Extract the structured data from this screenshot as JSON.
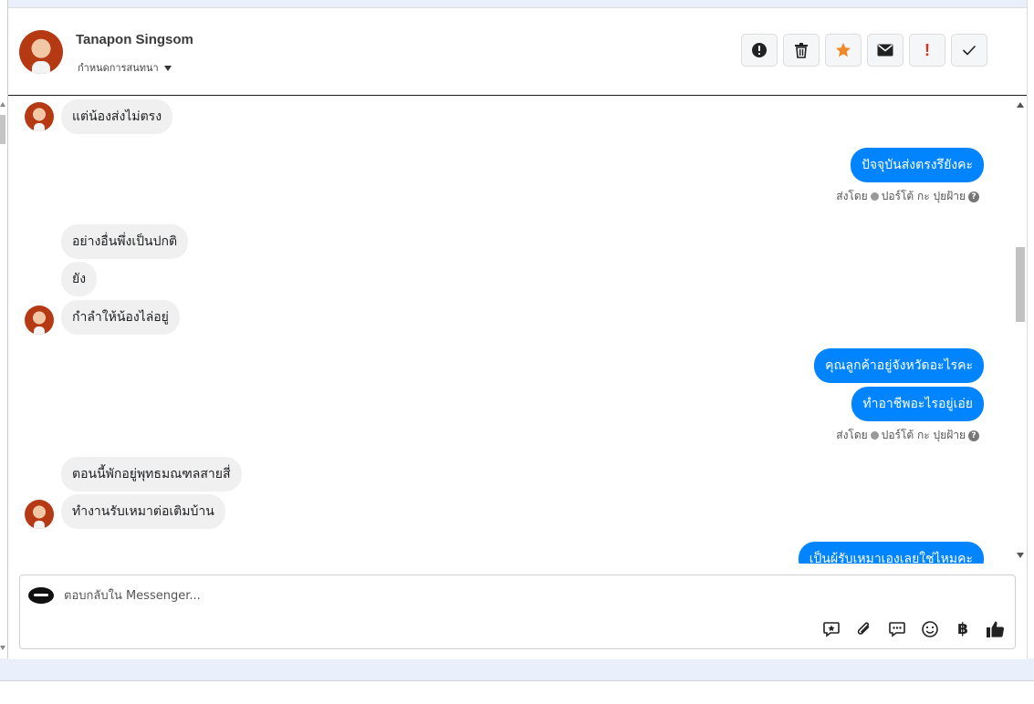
{
  "contact": {
    "name": "Tanapon Singsom",
    "assign_label": "กำหนดการสนทนา"
  },
  "actions": [
    {
      "name": "report-spam-button",
      "icon": "exclamation-circle-icon"
    },
    {
      "name": "delete-button",
      "icon": "trash-icon"
    },
    {
      "name": "star-button",
      "icon": "star-icon",
      "color": "#f0892a"
    },
    {
      "name": "mark-unread-button",
      "icon": "envelope-icon"
    },
    {
      "name": "important-button",
      "icon": "exclamation-icon",
      "label": "!",
      "color": "#e02d1a"
    },
    {
      "name": "mark-done-button",
      "icon": "check-icon"
    }
  ],
  "messages": [
    {
      "side": "in",
      "text": "แต่น้องส่งไม่ตรง"
    },
    {
      "side": "out",
      "text": "ปัจจุบันส่งตรงรึยังคะ"
    },
    {
      "side": "in",
      "text": "อย่างอื่นพึ่งเป็นปกติ"
    },
    {
      "side": "in",
      "text": "ยัง"
    },
    {
      "side": "in",
      "text": "กำลำให้น้องไล่อยู่"
    },
    {
      "side": "out",
      "text": "คุณลูกค้าอยู่จังหวัดอะไรคะ"
    },
    {
      "side": "out",
      "text": "ทำอาชีพอะไรอยู่เอ่ย"
    },
    {
      "side": "in",
      "text": "ตอนนี้พักอยู่พุทธมณฑลสายสี่"
    },
    {
      "side": "in",
      "text": "ทำงานรับเหมาต่อเติมบ้าน"
    },
    {
      "side": "out",
      "text": "เป็นผู้รับเหมาเองเลยใช่ไหมคะ"
    }
  ],
  "sent_by": {
    "prefix": "ส่งโดย",
    "agent": "ปอร์โต้ กะ ปุยฝ้าย"
  },
  "composer": {
    "placeholder": "ตอบกลับใน Messenger..."
  },
  "composer_tools": [
    "saved-reply-icon",
    "paperclip-icon",
    "chat-bubble-icon",
    "smiley-icon",
    "baht-icon",
    "thumbs-up-icon"
  ],
  "baht_symbol": "฿",
  "colors": {
    "outgoing_bubble": "#0084ff",
    "incoming_bubble": "#f0f0f0"
  }
}
